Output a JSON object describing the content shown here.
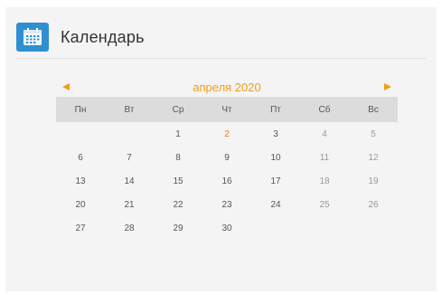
{
  "header": {
    "title": "Календарь",
    "icon": "calendar-icon"
  },
  "calendar": {
    "month_label": "апреля 2020",
    "prev_icon": "triangle-left-icon",
    "next_icon": "triangle-right-icon",
    "accent_color": "#f39c12",
    "weekdays": [
      "Пн",
      "Вт",
      "Ср",
      "Чт",
      "Пт",
      "Сб",
      "Вс"
    ],
    "today": "2",
    "weeks": [
      [
        "",
        "",
        "1",
        "2",
        "3",
        "4",
        "5"
      ],
      [
        "6",
        "7",
        "8",
        "9",
        "10",
        "11",
        "12"
      ],
      [
        "13",
        "14",
        "15",
        "16",
        "17",
        "18",
        "19"
      ],
      [
        "20",
        "21",
        "22",
        "23",
        "24",
        "25",
        "26"
      ],
      [
        "27",
        "28",
        "29",
        "30",
        "",
        "",
        ""
      ]
    ]
  }
}
